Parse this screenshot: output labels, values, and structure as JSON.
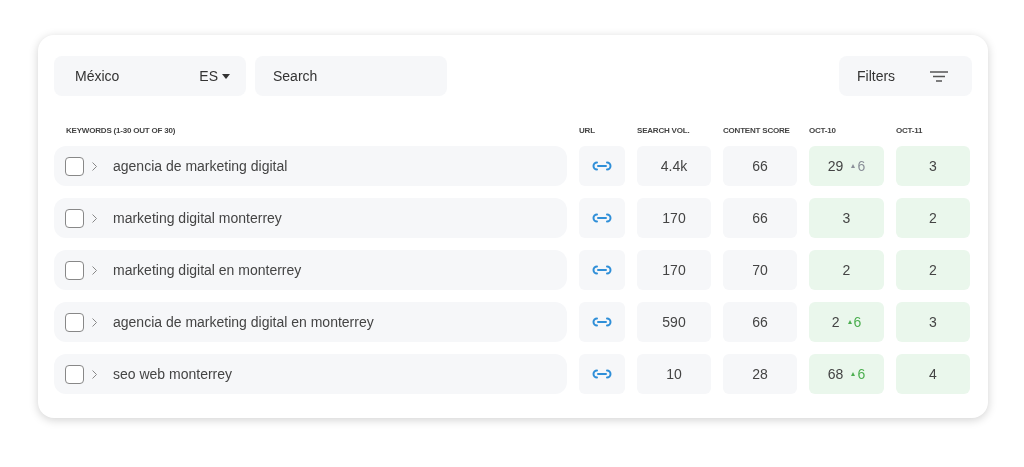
{
  "toolbar": {
    "country": "México",
    "language": "ES",
    "search": {
      "placeholder": "Search"
    },
    "filters": "Filters"
  },
  "table": {
    "columns": [
      "KEYWORDS (1-30 OUT OF 30)",
      "URL",
      "SEARCH VOL.",
      "CONTENT SCORE",
      "OCT-10",
      "OCT-11"
    ],
    "rows": [
      {
        "checked": false,
        "keyword": "agencia de marketing digital",
        "search_vol": "4.4k",
        "content_score": "66",
        "oct10": "29",
        "change": {
          "value": "6",
          "color": "#8a8f98"
        },
        "oct11": "3"
      },
      {
        "checked": false,
        "keyword": "marketing digital monterrey",
        "search_vol": "170",
        "content_score": "66",
        "oct10": "3",
        "oct11": "2"
      },
      {
        "checked": false,
        "keyword": "marketing digital en monterrey",
        "search_vol": "170",
        "content_score": "70",
        "oct10": "2",
        "oct11": "2"
      },
      {
        "checked": false,
        "keyword": "agencia de marketing digital en monterrey",
        "search_vol": "590",
        "content_score": "66",
        "oct10": "2",
        "change": {
          "value": "6",
          "color": "#4caf50"
        },
        "oct11": "3"
      },
      {
        "checked": false,
        "keyword": "seo web monterrey",
        "search_vol": "10",
        "content_score": "28",
        "oct10": "68",
        "change": {
          "value": "6",
          "color": "#4caf50"
        },
        "oct11": "4"
      }
    ]
  }
}
